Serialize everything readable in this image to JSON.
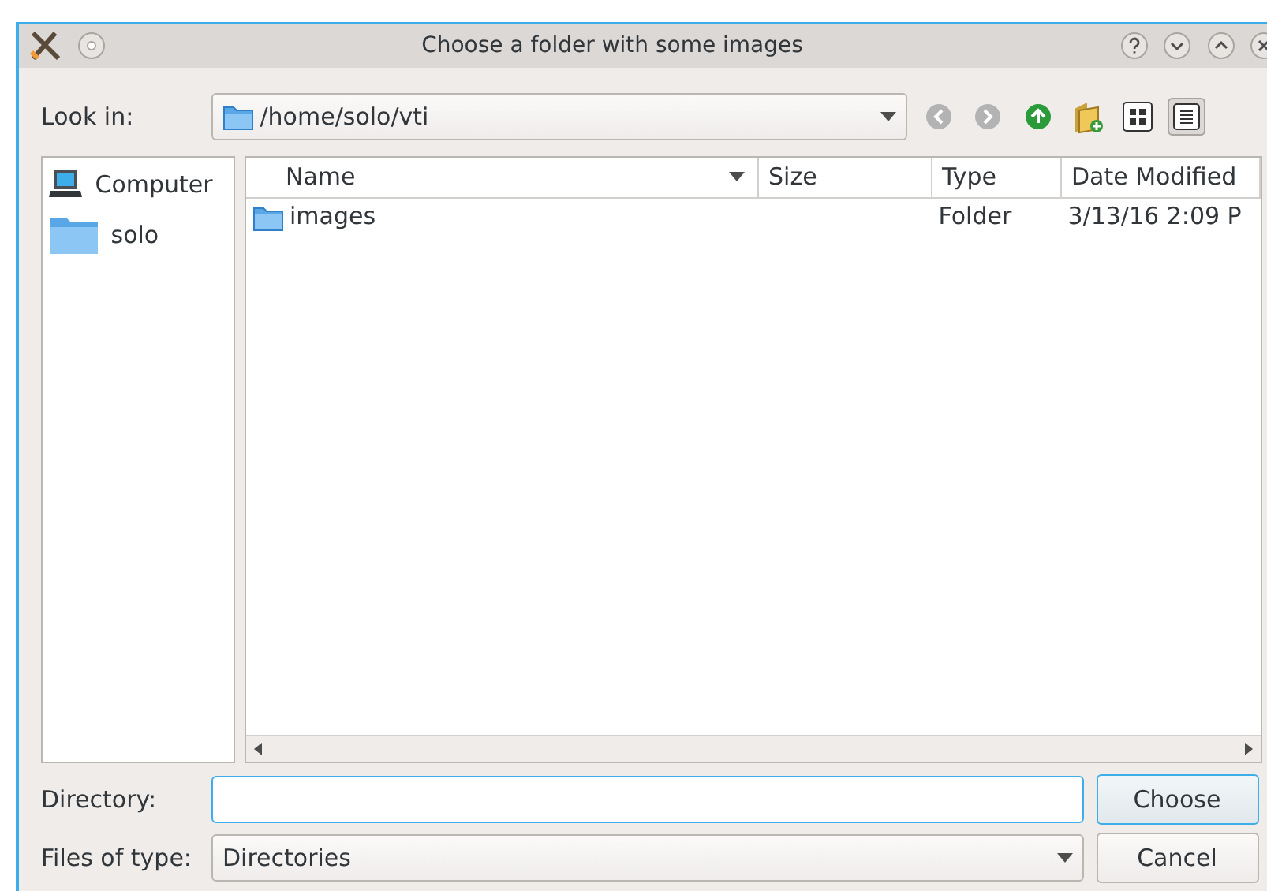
{
  "window": {
    "title": "Choose a folder with some images"
  },
  "look_in": {
    "label": "Look in:",
    "value": "/home/solo/vti"
  },
  "sidebar": {
    "items": [
      {
        "label": "Computer",
        "kind": "computer"
      },
      {
        "label": "solo",
        "kind": "folder"
      }
    ]
  },
  "table": {
    "columns": [
      {
        "label": "Name",
        "sorted": true
      },
      {
        "label": "Size",
        "sorted": false
      },
      {
        "label": "Type",
        "sorted": false
      },
      {
        "label": "Date Modified",
        "sorted": false
      }
    ],
    "rows": [
      {
        "name": "images",
        "type": "Folder",
        "date": "3/13/16 2:09 P"
      }
    ]
  },
  "directory": {
    "label": "Directory:"
  },
  "files_of_type": {
    "label": "Files of type:",
    "value": "Directories"
  },
  "buttons": [
    {
      "label": "Choose",
      "default": true
    },
    {
      "label": "Cancel",
      "default": false
    }
  ]
}
